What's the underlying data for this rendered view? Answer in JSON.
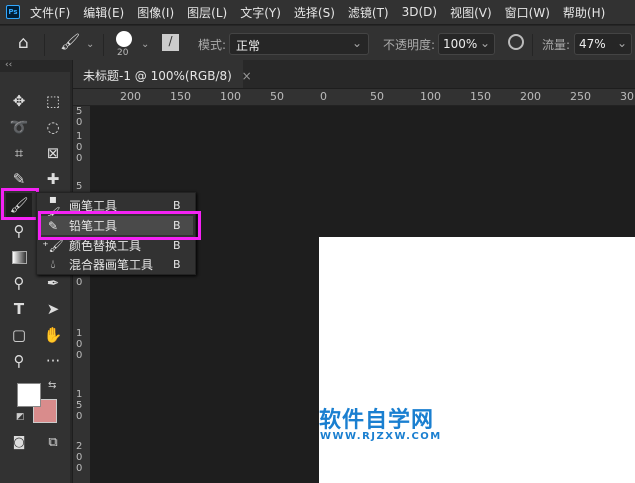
{
  "app": {
    "logo": "Ps"
  },
  "menu": [
    "文件(F)",
    "编辑(E)",
    "图像(I)",
    "图层(L)",
    "文字(Y)",
    "选择(S)",
    "滤镜(T)",
    "3D(D)",
    "视图(V)",
    "窗口(W)",
    "帮助(H)"
  ],
  "options": {
    "brush_size": "20",
    "mode_label": "模式:",
    "mode_value": "正常",
    "opacity_label": "不透明度:",
    "opacity_value": "100%",
    "flow_label": "流量:",
    "flow_value": "47%"
  },
  "document_tab": {
    "title": "未标题-1 @ 100%(RGB/8)",
    "close": "×"
  },
  "ruler": {
    "horizontal": [
      "200",
      "150",
      "100",
      "50",
      "0",
      "50",
      "100",
      "150",
      "200",
      "250",
      "30"
    ],
    "vertical": [
      "50",
      "100",
      "5",
      "50",
      "100",
      "150",
      "200"
    ]
  },
  "flyout": {
    "items": [
      {
        "label": "画笔工具",
        "key": "B",
        "icon": "brush-icon",
        "active": true
      },
      {
        "label": "铅笔工具",
        "key": "B",
        "icon": "pencil-icon"
      },
      {
        "label": "颜色替换工具",
        "key": "B",
        "icon": "color-replace-icon"
      },
      {
        "label": "混合器画笔工具",
        "key": "B",
        "icon": "mixer-brush-icon"
      }
    ]
  },
  "colors": {
    "foreground": "#ffffff",
    "background": "#d98c8c",
    "highlight": "#f522f5",
    "accent": "#31a8ff"
  },
  "watermark": {
    "title": "软件自学网",
    "url": "WWW.RJZXW.COM"
  }
}
